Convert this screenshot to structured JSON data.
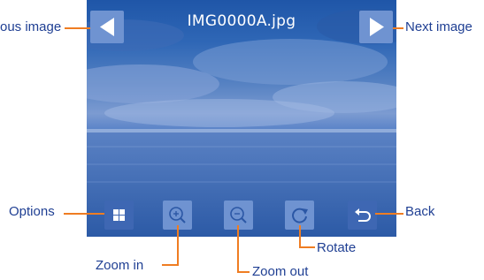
{
  "viewer": {
    "filename": "IMG0000A.jpg"
  },
  "callouts": {
    "previous_image": "ous image",
    "next_image": "Next image",
    "options": "Options",
    "back": "Back",
    "rotate": "Rotate",
    "zoom_in": "Zoom in",
    "zoom_out": "Zoom out"
  },
  "icons": {
    "previous": "triangle-left-icon",
    "next": "triangle-right-icon",
    "options": "grid-icon",
    "zoom_in": "magnifier-plus-icon",
    "zoom_out": "magnifier-minus-icon",
    "rotate": "rotate-icon",
    "back": "back-arrow-icon"
  },
  "colors": {
    "callout_text": "#1f3f93",
    "callout_line": "#ef7d22",
    "button": "#6f93d1",
    "sky": "#2f67b6"
  }
}
